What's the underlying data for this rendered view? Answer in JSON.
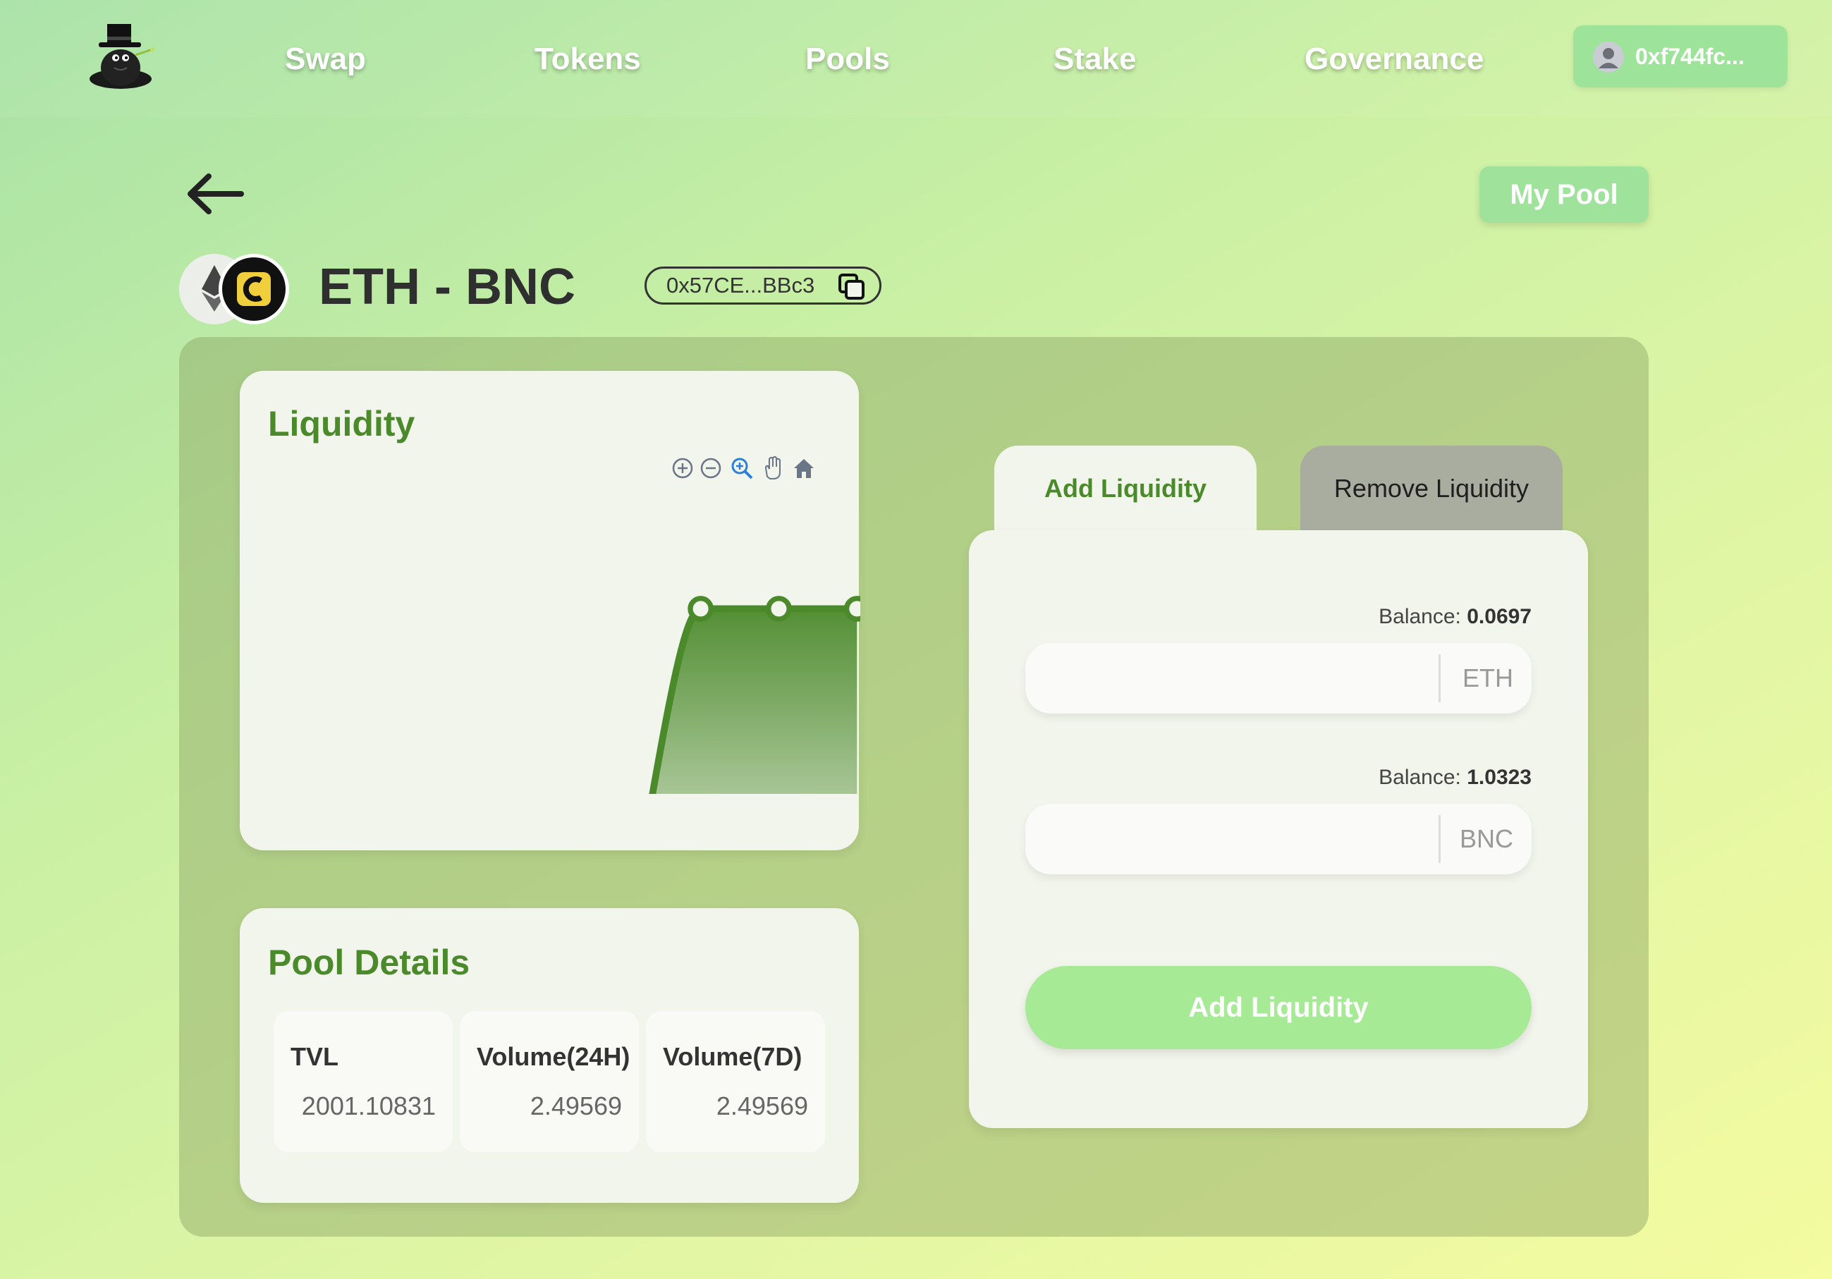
{
  "nav": {
    "items": [
      {
        "label": "Swap"
      },
      {
        "label": "Tokens"
      },
      {
        "label": "Pools"
      },
      {
        "label": "Stake"
      },
      {
        "label": "Governance"
      }
    ],
    "wallet_address": "0xf744fc..."
  },
  "header": {
    "my_pool_label": "My Pool",
    "pair_title": "ETH - BNC",
    "pool_address": "0x57CE...BBc3"
  },
  "liquidity_card": {
    "title": "Liquidity",
    "toolbar_icons": [
      "zoom-in-icon",
      "zoom-out-icon",
      "zoom-select-icon",
      "pan-hand-icon",
      "home-reset-icon"
    ]
  },
  "chart_data": {
    "type": "area",
    "title": "Liquidity",
    "xlabel": "",
    "ylabel": "",
    "color": "#4b8a2b",
    "series": [
      {
        "values": [
          0,
          1,
          1,
          1
        ]
      }
    ]
  },
  "pool_details": {
    "title": "Pool Details",
    "stats": [
      {
        "label": "TVL",
        "value": "2001.10831"
      },
      {
        "label": "Volume(24H)",
        "value": "2.49569"
      },
      {
        "label": "Volume(7D)",
        "value": "2.49569"
      }
    ]
  },
  "form": {
    "tabs": [
      {
        "label": "Add Liquidity",
        "active": true
      },
      {
        "label": "Remove Liquidity",
        "active": false
      }
    ],
    "balance_label": "Balance:",
    "inputs": [
      {
        "balance": "0.0697",
        "unit": "ETH",
        "value": ""
      },
      {
        "balance": "1.0323",
        "unit": "BNC",
        "value": ""
      }
    ],
    "submit_label": "Add Liquidity"
  },
  "colors": {
    "accent_green": "#4b8a2b",
    "button_green": "#9fe29b"
  }
}
